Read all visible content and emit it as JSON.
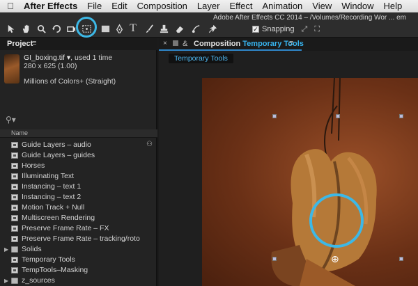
{
  "menubar": {
    "apple_icon": "apple-icon",
    "items": [
      "After Effects",
      "File",
      "Edit",
      "Composition",
      "Layer",
      "Effect",
      "Animation",
      "View",
      "Window",
      "Help"
    ]
  },
  "window": {
    "title": "Adobe After Effects CC 2014 – /Volumes/Recording Wor ... em"
  },
  "toolbar": {
    "snapping_label": "Snapping",
    "snapping_checked": true,
    "tools": [
      "selection-tool-icon",
      "hand-tool-icon",
      "zoom-tool-icon",
      "rotation-tool-icon",
      "camera-tool-icon",
      "pan-behind-tool-icon",
      "mask-tool-icon",
      "pen-tool-icon",
      "type-tool-icon",
      "brush-tool-icon",
      "clone-stamp-tool-icon",
      "eraser-tool-icon",
      "roto-brush-tool-icon",
      "puppet-pin-tool-icon"
    ],
    "highlight_color": "#3db8e6"
  },
  "project": {
    "tab_label": "Project",
    "file": {
      "name": "GI_boxing.tif ▾",
      "usage": ", used 1 time",
      "dimensions": "280 x 625 (1.00)",
      "colors": "Millions of Colors+ (Straight)"
    },
    "search_placeholder": "",
    "column_name": "Name",
    "items": [
      {
        "label": "Guide Layers – audio",
        "type": "comp"
      },
      {
        "label": "Guide Layers – guides",
        "type": "comp"
      },
      {
        "label": "Horses",
        "type": "comp"
      },
      {
        "label": "Illuminating Text",
        "type": "comp"
      },
      {
        "label": "Instancing – text 1",
        "type": "comp"
      },
      {
        "label": "Instancing – text 2",
        "type": "comp"
      },
      {
        "label": "Motion Track + Null",
        "type": "comp"
      },
      {
        "label": "Multiscreen Rendering",
        "type": "comp"
      },
      {
        "label": "Preserve Frame Rate – FX",
        "type": "comp"
      },
      {
        "label": "Preserve Frame Rate – tracking/roto",
        "type": "comp"
      },
      {
        "label": "Solids",
        "type": "folder"
      },
      {
        "label": "Temporary Tools",
        "type": "comp"
      },
      {
        "label": "TempTools–Masking",
        "type": "comp"
      },
      {
        "label": "z_sources",
        "type": "folder"
      }
    ]
  },
  "composition": {
    "tab_prefix": "Composition",
    "tab_name": "Temporary Tools",
    "subtab": "Temporary Tools",
    "accent": "#37b3ee"
  }
}
